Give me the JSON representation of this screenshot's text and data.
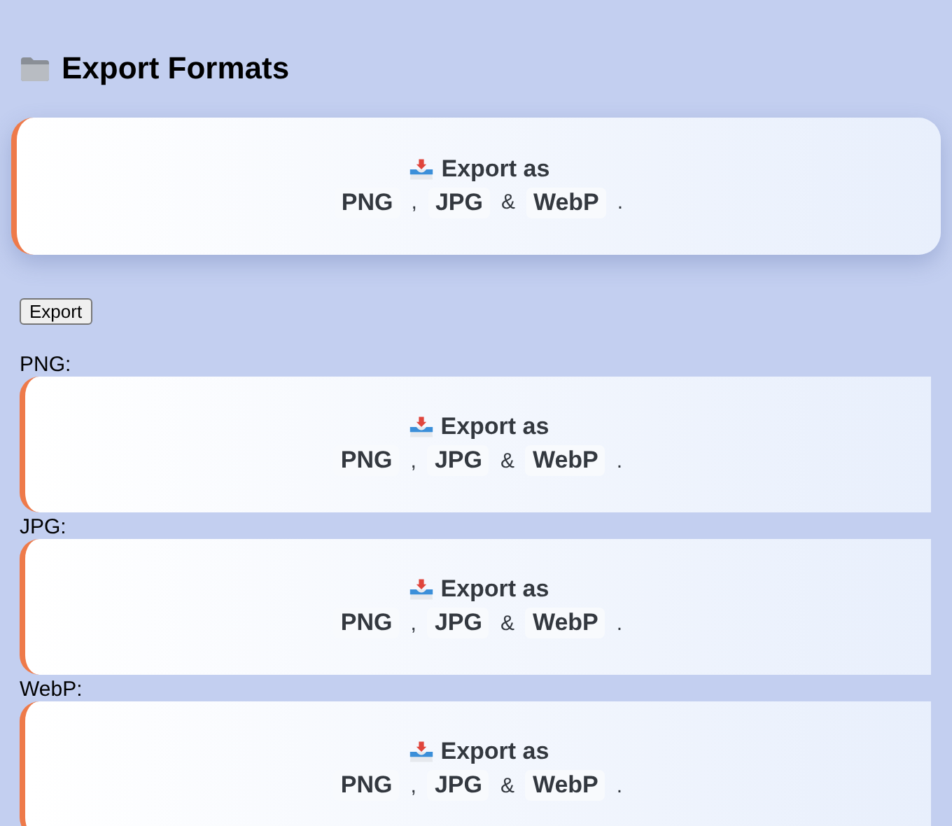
{
  "title": "Export Formats",
  "hero": {
    "heading": "Export as",
    "parts": [
      {
        "kind": "chip",
        "text": "PNG"
      },
      {
        "kind": "sep",
        "text": ","
      },
      {
        "kind": "chip",
        "text": "JPG"
      },
      {
        "kind": "sep",
        "text": "&"
      },
      {
        "kind": "chip",
        "text": "WebP"
      },
      {
        "kind": "sep",
        "text": "."
      }
    ]
  },
  "button": "Export",
  "previews": [
    {
      "label": "PNG:",
      "card": {
        "heading": "Export as",
        "parts": [
          {
            "kind": "chip",
            "text": "PNG"
          },
          {
            "kind": "sep",
            "text": ","
          },
          {
            "kind": "chip",
            "text": "JPG"
          },
          {
            "kind": "sep",
            "text": "&"
          },
          {
            "kind": "chip",
            "text": "WebP"
          },
          {
            "kind": "sep",
            "text": "."
          }
        ]
      }
    },
    {
      "label": "JPG:",
      "card": {
        "heading": "Export as",
        "parts": [
          {
            "kind": "chip",
            "text": "PNG"
          },
          {
            "kind": "sep",
            "text": ","
          },
          {
            "kind": "chip",
            "text": "JPG"
          },
          {
            "kind": "sep",
            "text": "&"
          },
          {
            "kind": "chip",
            "text": "WebP"
          },
          {
            "kind": "sep",
            "text": "."
          }
        ]
      }
    },
    {
      "label": "WebP:",
      "card": {
        "heading": "Export as",
        "parts": [
          {
            "kind": "chip",
            "text": "PNG"
          },
          {
            "kind": "sep",
            "text": ","
          },
          {
            "kind": "chip",
            "text": "JPG"
          },
          {
            "kind": "sep",
            "text": "&"
          },
          {
            "kind": "chip",
            "text": "WebP"
          },
          {
            "kind": "sep",
            "text": "."
          }
        ]
      }
    }
  ]
}
